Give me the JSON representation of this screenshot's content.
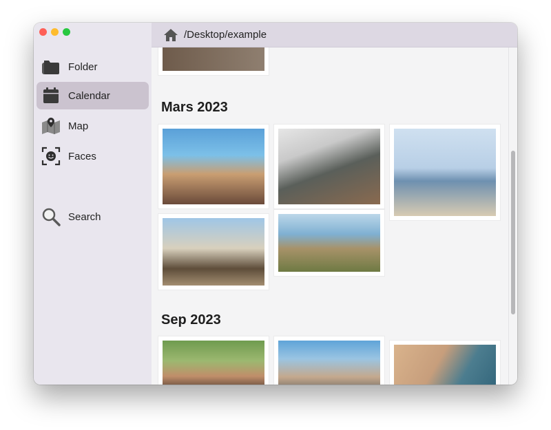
{
  "window": {
    "traffic_lights": {
      "close": "#fe5f57",
      "minimize": "#febc2e",
      "zoom": "#28c840"
    }
  },
  "sidebar": {
    "items": [
      {
        "label": "Folder",
        "icon": "folder-icon",
        "selected": false
      },
      {
        "label": "Calendar",
        "icon": "calendar-icon",
        "selected": true
      },
      {
        "label": "Map",
        "icon": "map-icon",
        "selected": false
      },
      {
        "label": "Faces",
        "icon": "faces-icon",
        "selected": false
      },
      {
        "label": "Search",
        "icon": "search-icon",
        "selected": false
      }
    ],
    "selected_color": "#cbc3cf"
  },
  "toolbar": {
    "home_icon": "home-icon",
    "path": "/Desktop/example"
  },
  "sections": [
    {
      "title": "Mars 2023"
    },
    {
      "title": "Sep 2023"
    }
  ],
  "colors": {
    "sidebar_bg": "#e9e6ee",
    "toolbar_bg": "#ddd8e3",
    "content_bg": "#f4f4f5"
  }
}
